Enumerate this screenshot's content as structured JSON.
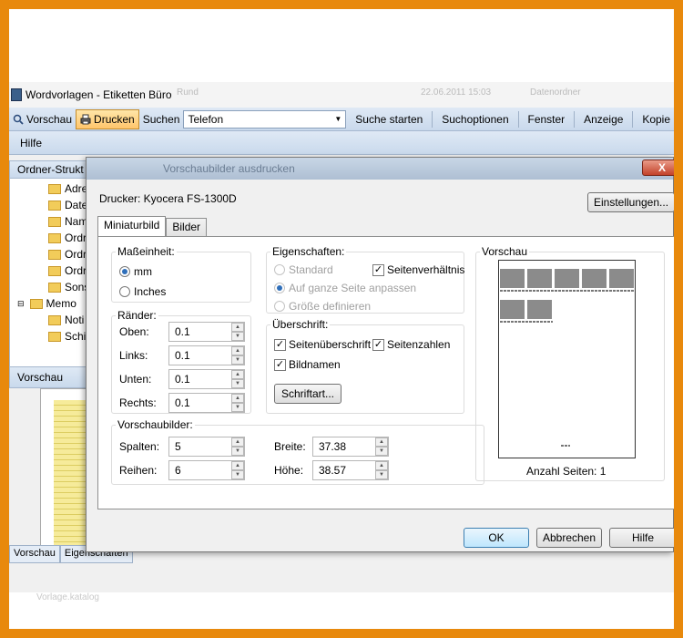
{
  "app": {
    "title": "Wordvorlagen - Etiketten Büro",
    "bg_listing": [
      "Rund",
      "22.06.2011 15:03",
      "Datenordner"
    ]
  },
  "toolbar": {
    "vorschau": "Vorschau",
    "drucken": "Drucken",
    "suchen": "Suchen",
    "search_value": "Telefon",
    "suche_starten": "Suche starten",
    "suchoptionen": "Suchoptionen",
    "fenster": "Fenster",
    "anzeige": "Anzeige",
    "kopie": "Kopie"
  },
  "menu": {
    "hilfe": "Hilfe"
  },
  "left_panel": {
    "header": "Ordner-Strukt",
    "items": [
      "Adre",
      "Date",
      "Nam",
      "Ordr",
      "Ordr",
      "Ordr",
      "Sons",
      "Memo",
      "Noti",
      "Schi"
    ],
    "preview_header": "Vorschau",
    "bottom_tabs": [
      "Vorschau",
      "Eigenschaften"
    ]
  },
  "dialog": {
    "title": "Vorschaubilder ausdrucken",
    "close": "X",
    "printer_label": "Drucker: Kyocera FS-1300D",
    "settings_button": "Einstellungen...",
    "tabs": [
      "Miniaturbild",
      "Bilder"
    ],
    "unit": {
      "label": "Maßeinheit:",
      "options": [
        "mm",
        "Inches"
      ],
      "selected": "mm"
    },
    "margins": {
      "label": "Ränder:",
      "rows": [
        {
          "label": "Oben:",
          "value": "0.1"
        },
        {
          "label": "Links:",
          "value": "0.1"
        },
        {
          "label": "Unten:",
          "value": "0.1"
        },
        {
          "label": "Rechts:",
          "value": "0.1"
        }
      ]
    },
    "properties": {
      "label": "Eigenschaften:",
      "standard": "Standard",
      "aspect_ratio": "Seitenverhältnis",
      "fit_page": "Auf ganze Seite anpassen",
      "define_size": "Größe definieren"
    },
    "heading": {
      "label": "Überschrift:",
      "page_heading": "Seitenüberschrift",
      "page_numbers": "Seitenzahlen",
      "image_names": "Bildnamen",
      "font_button": "Schriftart..."
    },
    "thumbs": {
      "label": "Vorschaubilder:",
      "columns_label": "Spalten:",
      "columns_value": "5",
      "rows_label": "Reihen:",
      "rows_value": "6",
      "width_label": "Breite:",
      "width_value": "37.38",
      "height_label": "Höhe:",
      "height_value": "38.57"
    },
    "preview": {
      "label": "Vorschau",
      "pages_label": "Anzahl Seiten:",
      "pages_value": "1"
    },
    "ok": "OK",
    "cancel": "Abbrechen",
    "help": "Hilfe"
  },
  "watermark": "Vorlage.katalog"
}
